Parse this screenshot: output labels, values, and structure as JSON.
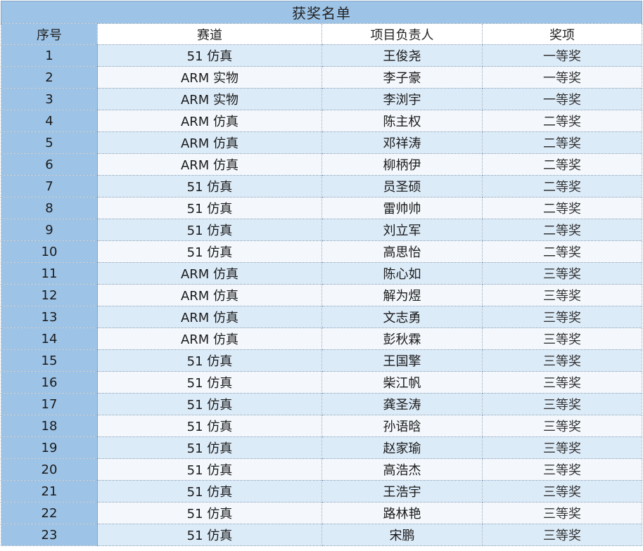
{
  "title": "获奖名单",
  "headers": [
    "序号",
    "赛道",
    "项目负责人",
    "奖项"
  ],
  "rows": [
    {
      "no": "1",
      "track": "51 仿真",
      "leader": "王俊尧",
      "award": "一等奖"
    },
    {
      "no": "2",
      "track": "ARM 实物",
      "leader": "李子豪",
      "award": "一等奖"
    },
    {
      "no": "3",
      "track": "ARM 实物",
      "leader": "李浏宇",
      "award": "一等奖"
    },
    {
      "no": "4",
      "track": "ARM 仿真",
      "leader": "陈主权",
      "award": "二等奖"
    },
    {
      "no": "5",
      "track": "ARM 仿真",
      "leader": "邓祥涛",
      "award": "二等奖"
    },
    {
      "no": "6",
      "track": "ARM 仿真",
      "leader": "柳柄伊",
      "award": "二等奖"
    },
    {
      "no": "7",
      "track": "51 仿真",
      "leader": "员圣硕",
      "award": "二等奖"
    },
    {
      "no": "8",
      "track": "51 仿真",
      "leader": "雷帅帅",
      "award": "二等奖"
    },
    {
      "no": "9",
      "track": "51 仿真",
      "leader": "刘立军",
      "award": "二等奖"
    },
    {
      "no": "10",
      "track": "51 仿真",
      "leader": "高思怡",
      "award": "二等奖"
    },
    {
      "no": "11",
      "track": "ARM 仿真",
      "leader": "陈心如",
      "award": "三等奖"
    },
    {
      "no": "12",
      "track": "ARM 仿真",
      "leader": "解为煜",
      "award": "三等奖"
    },
    {
      "no": "13",
      "track": "ARM 仿真",
      "leader": "文志勇",
      "award": "三等奖"
    },
    {
      "no": "14",
      "track": "ARM 仿真",
      "leader": "彭秋霖",
      "award": "三等奖"
    },
    {
      "no": "15",
      "track": "51 仿真",
      "leader": "王国擎",
      "award": "三等奖"
    },
    {
      "no": "16",
      "track": "51 仿真",
      "leader": "柴江帆",
      "award": "三等奖"
    },
    {
      "no": "17",
      "track": "51 仿真",
      "leader": "龚圣涛",
      "award": "三等奖"
    },
    {
      "no": "18",
      "track": "51 仿真",
      "leader": "孙语晗",
      "award": "三等奖"
    },
    {
      "no": "19",
      "track": "51 仿真",
      "leader": "赵家瑜",
      "award": "三等奖"
    },
    {
      "no": "20",
      "track": "51 仿真",
      "leader": "高浩杰",
      "award": "三等奖"
    },
    {
      "no": "21",
      "track": "51 仿真",
      "leader": "王浩宇",
      "award": "三等奖"
    },
    {
      "no": "22",
      "track": "51 仿真",
      "leader": "路林艳",
      "award": "三等奖"
    },
    {
      "no": "23",
      "track": "51 仿真",
      "leader": "宋鹏",
      "award": "三等奖"
    }
  ],
  "colors": {
    "title_bg": "#9dc3e6",
    "index_bg": "#9dc3e6",
    "band_dark": "#dcebf8",
    "band_light": "#f4f8fc"
  }
}
